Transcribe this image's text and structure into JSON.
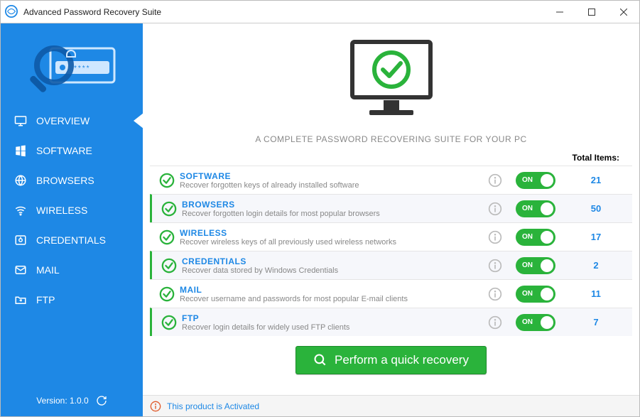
{
  "app": {
    "title": "Advanced Password Recovery Suite"
  },
  "sidebar": {
    "items": [
      {
        "label": "OVERVIEW"
      },
      {
        "label": "SOFTWARE"
      },
      {
        "label": "BROWSERS"
      },
      {
        "label": "WIRELESS"
      },
      {
        "label": "CREDENTIALS"
      },
      {
        "label": "MAIL"
      },
      {
        "label": "FTP"
      }
    ],
    "version_label": "Version: 1.0.0"
  },
  "main": {
    "tagline": "A COMPLETE PASSWORD RECOVERING SUITE FOR YOUR PC",
    "total_label": "Total Items:",
    "categories": [
      {
        "title": "SOFTWARE",
        "desc": "Recover forgotten keys of already installed software",
        "toggle": "ON",
        "count": "21"
      },
      {
        "title": "BROWSERS",
        "desc": "Recover forgotten login details for most popular browsers",
        "toggle": "ON",
        "count": "50"
      },
      {
        "title": "WIRELESS",
        "desc": "Recover wireless keys of all previously used wireless networks",
        "toggle": "ON",
        "count": "17"
      },
      {
        "title": "CREDENTIALS",
        "desc": "Recover data stored by Windows Credentials",
        "toggle": "ON",
        "count": "2"
      },
      {
        "title": "MAIL",
        "desc": "Recover username and passwords for most popular E-mail clients",
        "toggle": "ON",
        "count": "11"
      },
      {
        "title": "FTP",
        "desc": "Recover login details for widely used FTP clients",
        "toggle": "ON",
        "count": "7"
      }
    ],
    "action_label": "Perform a quick recovery"
  },
  "status": {
    "text": "This product is Activated"
  }
}
